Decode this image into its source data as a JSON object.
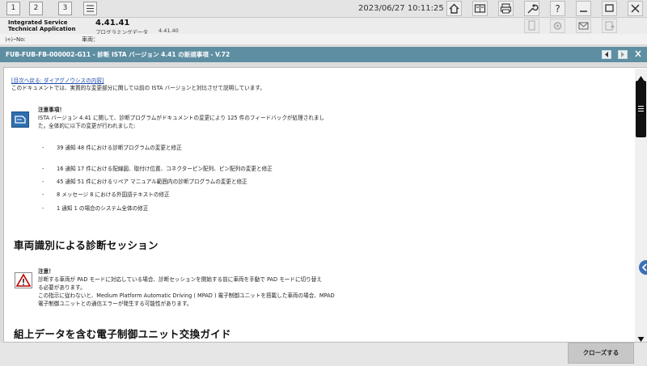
{
  "toolbar": {
    "tabs": [
      "1",
      "2",
      "3"
    ],
    "datetime": "2023/06/27 10:11:25"
  },
  "app": {
    "name": "Integrated Service Technical Application",
    "version": "4.41.41",
    "data_label": "プログラミングデータ",
    "data_version": "4.41.40"
  },
  "vehicle": {
    "chassis_label": "ｼｬｼｰNo:",
    "vehicle_label": "車両："
  },
  "document": {
    "title": "FUB-FUB-FB-000002-G11 - 診断 ISTA バージョン 4.41 の新規事項 - V.72",
    "back_link": "[目次へ戻る: ダイアグノウシスの内容]",
    "intro": "このドキュメントでは、実質的な変更部分に関して以前の ISTA バージョンと対比させて説明しています。",
    "note1": {
      "title": "注意事項！",
      "line1": "ISTA バージョン 4.41 に関して、診断プログラムがドキュメントの変更により 125 件のフィードバックが処理されまし",
      "line2": "た。全体的に以下の変更が行われました:"
    },
    "bullets": [
      "39 通知 48 件における診断プログラムの変更と修正",
      "16 通知 17 件における配線図、取付け位置、コネクターピン配列、ピン配列の変更と修正",
      "45 通知 51 件におけるリペア マニュアル範囲内の診断プログラムの変更と修正",
      "8 メッセージ 8 における外国語テキストの修正",
      "1 通知 1 の場合のシステム全体の修正"
    ],
    "bullet_dash": "-",
    "section1": "車両識別による診断セッション",
    "note2": {
      "title": "注意！",
      "line1": "診断する車両が PAD モードに対応している場合、診断セッションを開始する前に車両を手動で PAD モードに切り替え",
      "line2": "る必要があります。",
      "line3": "この指示に従わないと、Medium Platform Automatic Driving ( MPAD ) 電子制御ユニットを搭載した車両の場合、MPAD",
      "line4": "電子制御ユニットとの通信エラーが発生する可能性があります。"
    },
    "section2": "組上データを含む電子制御ユニット交換ガイド"
  },
  "footer": {
    "close_label": "クローズする"
  },
  "colors": {
    "title_bar": "#5e8ea2",
    "link": "#1a4aa8",
    "note_icon": "#2f6fb0",
    "side_handle": "#3b6fb7"
  }
}
